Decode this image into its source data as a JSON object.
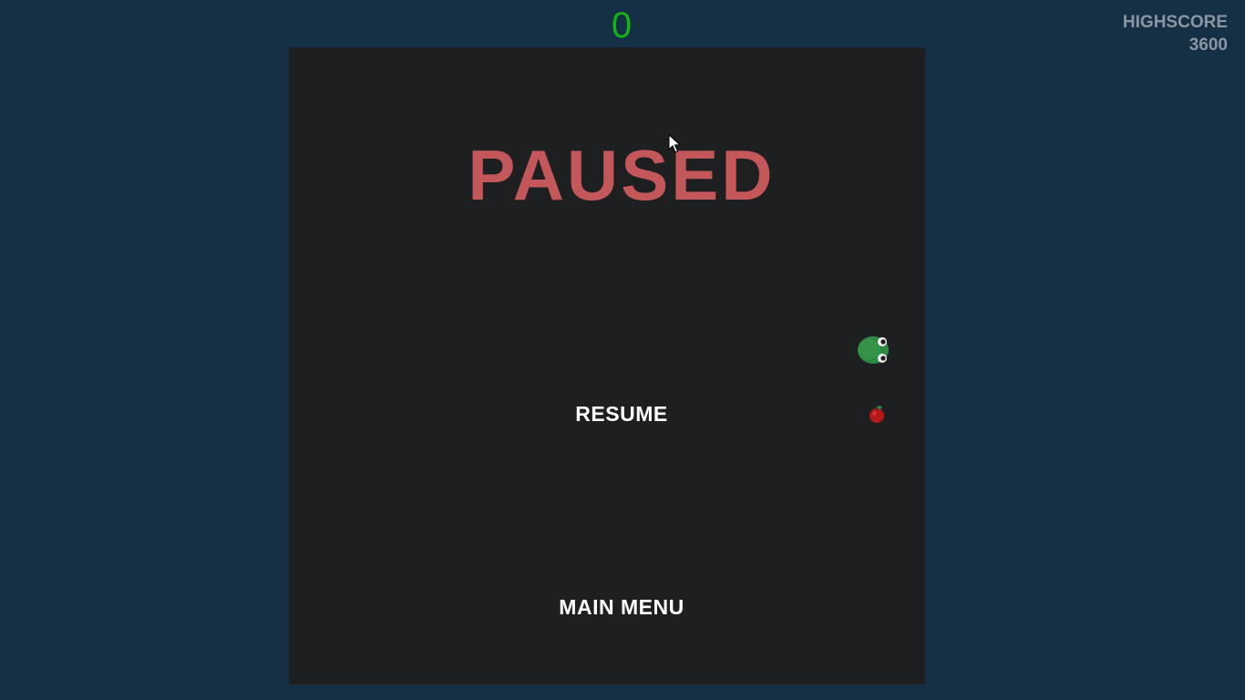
{
  "hud": {
    "score": "0",
    "highscore_label": "HIGHSCORE",
    "highscore_value": "3600"
  },
  "pause_menu": {
    "title": "PAUSED",
    "resume_label": "RESUME",
    "main_menu_label": "MAIN MENU"
  },
  "colors": {
    "background": "#152f45",
    "board": "#1e1f20",
    "score": "#16b314",
    "title": "#c3575a",
    "highscore": "#8a96a3",
    "snake": "#2e8a43",
    "apple": "#b41818"
  },
  "icons": {
    "snake_head": "snake-head-icon",
    "apple": "apple-icon",
    "cursor": "mouse-cursor-icon"
  }
}
